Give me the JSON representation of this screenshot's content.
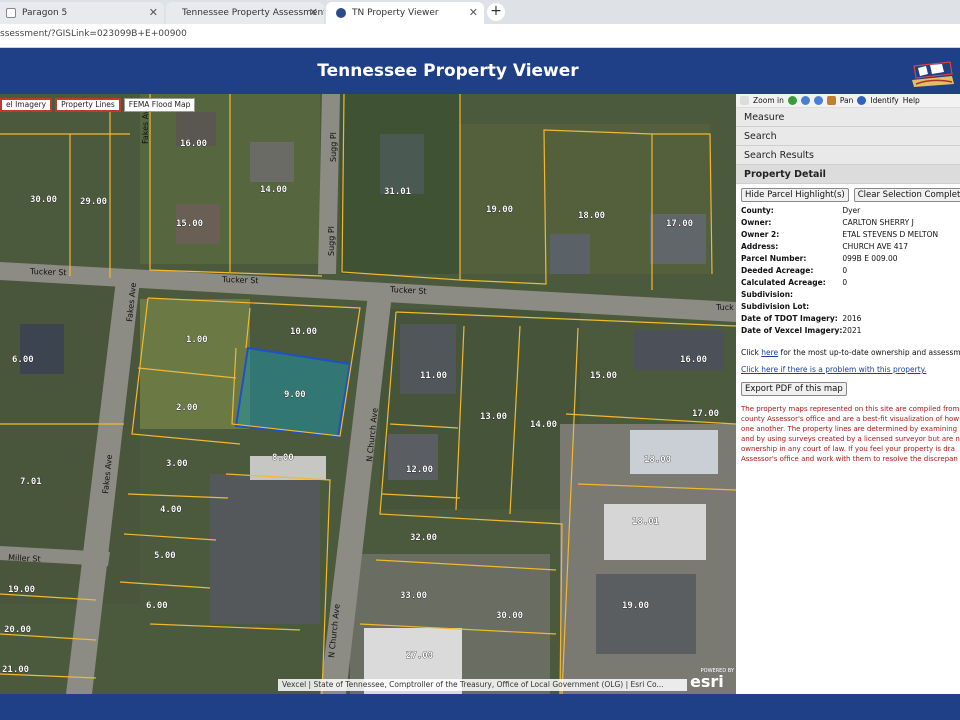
{
  "browser": {
    "tabs": [
      {
        "title": "Paragon 5",
        "active": false
      },
      {
        "title": "Tennessee Property Assessment D",
        "active": false
      },
      {
        "title": "TN Property Viewer",
        "active": true
      }
    ],
    "address": "ssessment/?GISLink=023099B+E+00900"
  },
  "app": {
    "title": "Tennessee Property Viewer"
  },
  "map": {
    "layer_buttons": [
      {
        "label": "el Imagery",
        "active": true
      },
      {
        "label": "Property Lines",
        "active": true
      },
      {
        "label": "FEMA Flood Map",
        "active": false
      }
    ],
    "streets": [
      "Tucker St",
      "Tucker St",
      "Tucker St",
      "Tuck",
      "Fakes Ave",
      "Fakes Ave",
      "Fakes Ave",
      "Sugg Pl",
      "Sugg Pl",
      "N Church Ave",
      "N Church Ave",
      "Miller St"
    ],
    "parcels": [
      "16.00",
      "14.00",
      "15.00",
      "30.00",
      "29.00",
      "31.01",
      "19.00",
      "18.00",
      "17.00",
      "1.00",
      "10.00",
      "9.00",
      "2.00",
      "3.00",
      "8.00",
      "4.00",
      "5.00",
      "6.00",
      "7.01",
      "6.00",
      "11.00",
      "13.00",
      "14.00",
      "12.00",
      "15.00",
      "16.00",
      "17.00",
      "18.00",
      "18.01",
      "19.00",
      "32.00",
      "30.00",
      "33.00",
      "27.00",
      "19.00",
      "20.00",
      "21.00"
    ],
    "attribution": "Vexcel | State of Tennessee, Comptroller of the Treasury, Office of Local Government (OLG) | Esri Co...",
    "esri_powered": "POWERED BY",
    "esri_name": "esri"
  },
  "toolbar": {
    "zoom_in": "Zoom in",
    "pan": "Pan",
    "identify": "Identify",
    "help": "Help"
  },
  "panels": {
    "measure": "Measure",
    "search": "Search",
    "search_results": "Search Results",
    "property_detail": "Property Detail"
  },
  "detail": {
    "hide_btn": "Hide Parcel Highlight(s)",
    "clear_btn": "Clear Selection Completely",
    "fields": [
      {
        "label": "County:",
        "value": "Dyer"
      },
      {
        "label": "Owner:",
        "value": "CARLTON SHERRY J"
      },
      {
        "label": "Owner 2:",
        "value": "ETAL STEVENS D MELTON"
      },
      {
        "label": "Address:",
        "value": "CHURCH AVE 417"
      },
      {
        "label": "Parcel Number:",
        "value": "099B E 009.00"
      },
      {
        "label": "Deeded Acreage:",
        "value": "0"
      },
      {
        "label": "Calculated Acreage:",
        "value": "0"
      },
      {
        "label": "Subdivision:",
        "value": ""
      },
      {
        "label": "Subdivision Lot:",
        "value": ""
      },
      {
        "label": "Date of TDOT Imagery:",
        "value": "2016"
      },
      {
        "label": "Date of Vexcel Imagery:",
        "value": "2021"
      }
    ],
    "click_prefix": "Click ",
    "click_link": "here",
    "click_suffix": " for the most up-to-date ownership and assessment",
    "problem_link": "Click here if there is a problem with this property.",
    "export_btn": "Export PDF of this map",
    "disclaimer": [
      "The property maps represented on this site are compiled from",
      "county Assessor's office and are a best-fit visualization of how",
      "one another. The property lines are determined by examining",
      "and by using surveys created by a licensed surveyor but are n",
      "ownership in any court of law. If you feel your property is dra",
      "Assessor's office and work with them to resolve the discrepan"
    ]
  }
}
